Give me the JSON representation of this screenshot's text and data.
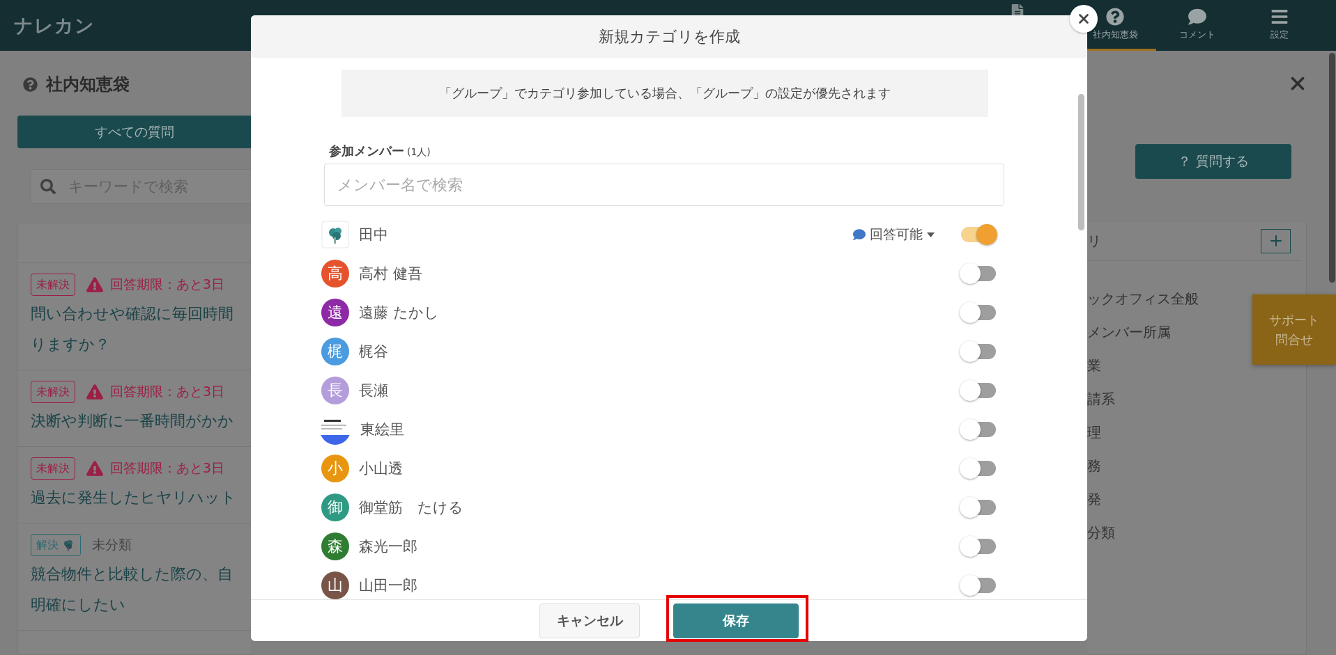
{
  "header": {
    "logo": "ナレカン",
    "nav": [
      {
        "label": "社内知恵袋",
        "kind": "question",
        "selected": true
      },
      {
        "label": "コメント",
        "kind": "comment",
        "selected": false
      },
      {
        "label": "設定",
        "kind": "menu",
        "selected": false
      }
    ]
  },
  "left": {
    "title": "社内知恵袋",
    "filter_button": "すべての質問",
    "search": {
      "placeholder": "キーワードで検索"
    },
    "questions": [
      {
        "kind": "deadline",
        "status": "未解決",
        "resolved": false,
        "deadline": "回答期限：あと3日",
        "title_lines": [
          "問い合わせや確認に毎回時間",
          "りますか？"
        ]
      },
      {
        "kind": "deadline",
        "status": "未解決",
        "resolved": false,
        "deadline": "回答期限：あと3日",
        "title_lines": [
          "決断や判断に一番時間がかか"
        ]
      },
      {
        "kind": "deadline",
        "status": "未解決",
        "resolved": false,
        "deadline": "回答期限：あと3日",
        "title_lines": [
          "過去に発生したヒヤリハット"
        ]
      },
      {
        "kind": "category",
        "status": "解決",
        "resolved": true,
        "category": "未分類",
        "title_lines": [
          "競合物件と比較した際の、自",
          "明確にしたい"
        ]
      }
    ]
  },
  "right": {
    "ask_button": "？ 質問する",
    "categories_heading": "リ",
    "categories": [
      "ックオフィス全般",
      "メンバー所属",
      "業",
      "請系",
      "理",
      "務",
      "発",
      "分類"
    ],
    "support_tab": [
      "サポート",
      "問合せ"
    ]
  },
  "dialog": {
    "title": "新規カテゴリを作成",
    "notice": "「グループ」でカテゴリ参加している場合、「グループ」の設定が優先されます",
    "members_label": "参加メンバー",
    "members_count": "(1人)",
    "search": {
      "placeholder": "メンバー名で検索"
    },
    "members": [
      {
        "name": "田中",
        "role": "回答可能",
        "on": true
      },
      {
        "name": "高村 健吾",
        "avatar": {
          "kind": "initial",
          "text": "高",
          "color": "#e5532d"
        },
        "on": false
      },
      {
        "name": "遠藤 たかし",
        "avatar": {
          "kind": "initial",
          "text": "遠",
          "color": "#8e2aa6"
        },
        "on": false
      },
      {
        "name": "梶谷",
        "avatar": {
          "kind": "initial",
          "text": "梶",
          "color": "#4a9be0"
        },
        "on": false
      },
      {
        "name": "長瀬",
        "avatar": {
          "kind": "initial",
          "text": "長",
          "color": "#b39ddb"
        },
        "on": false
      },
      {
        "name": "東絵里",
        "on": false
      },
      {
        "name": "小山透",
        "avatar": {
          "kind": "initial",
          "text": "小",
          "color": "#e8960f"
        },
        "on": false
      },
      {
        "name": "御堂筋　たける",
        "avatar": {
          "kind": "initial",
          "text": "御",
          "color": "#2f9a84"
        },
        "on": false
      },
      {
        "name": "森光一郎",
        "avatar": {
          "kind": "initial",
          "text": "森",
          "color": "#2e7d32"
        },
        "on": false
      },
      {
        "name": "山田一郎",
        "avatar": {
          "kind": "initial",
          "text": "山",
          "color": "#795548"
        },
        "on": false
      }
    ],
    "buttons": [
      {
        "label": "キャンセル",
        "kind": "secondary"
      },
      {
        "label": "保存",
        "kind": "primary",
        "highlighted": true
      }
    ]
  }
}
